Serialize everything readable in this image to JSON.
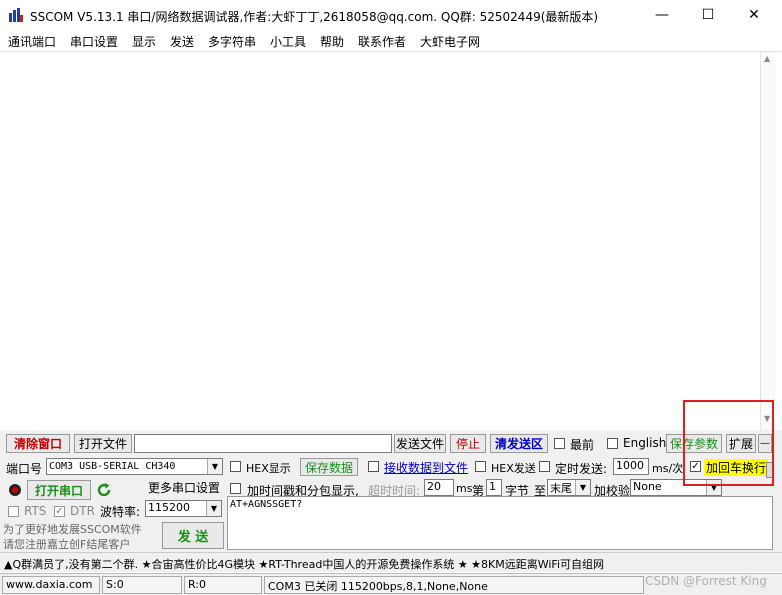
{
  "title": "SSCOM V5.13.1 串口/网络数据调试器,作者:大虾丁丁,2618058@qq.com. QQ群: 52502449(最新版本)",
  "window_controls": {
    "minimize": "—",
    "maximize": "☐",
    "close": "✕"
  },
  "menu": [
    "通讯端口",
    "串口设置",
    "显示",
    "发送",
    "多字符串",
    "小工具",
    "帮助",
    "联系作者",
    "大虾电子网"
  ],
  "toolbar": {
    "clear_window": "清除窗口",
    "open_file": "打开文件",
    "send_file": "发送文件",
    "stop": "停止",
    "clear_send": "清发送区",
    "topmost": "最前",
    "english": "English",
    "save_params": "保存参数",
    "expand": "扩展",
    "collapse": "—"
  },
  "port": {
    "label": "端口号",
    "value": "COM3 USB-SERIAL CH340",
    "open_button": "打开串口",
    "more_settings": "更多串口设置",
    "rts": "RTS",
    "dtr": "DTR",
    "baud_label": "波特率:",
    "baud_value": "115200"
  },
  "options": {
    "hex_display": "HEX显示",
    "save_data": "保存数据",
    "recv_to_file": "接收数据到文件",
    "hex_send": "HEX发送",
    "timed_send": "定时发送:",
    "interval_value": "1000",
    "interval_unit": "ms/次",
    "add_crlf": "加回车换行",
    "timestamp": "加时间戳和分包显示,",
    "timeout_label": "超时时间:",
    "timeout_value": "20",
    "timeout_unit": "ms",
    "byte_prefix": "第",
    "byte_value": "1",
    "byte_unit": "字节",
    "to_label": "至",
    "end_value": "末尾",
    "checksum_label": "加校验",
    "checksum_value": "None"
  },
  "promo": {
    "line1": "为了更好地发展SSCOM软件",
    "line2": "请您注册嘉立创F结尾客户"
  },
  "send_button": "发 送",
  "send_text": "AT+AGNSSGET?",
  "ticker": "▲Q群满员了,没有第二个群. ★合宙高性价比4G模块 ★RT-Thread中国人的开源免费操作系统 ★ ★8KM远距离WiFi可自组网",
  "status": {
    "website": "www.daxia.com",
    "sent": "S:0",
    "received": "R:0",
    "port_status": "COM3 已关闭  115200bps,8,1,None,None"
  },
  "watermark": "CSDN @Forrest King",
  "colors": {
    "accent_red": "#c00000",
    "accent_green": "#1a8f1a",
    "highlight_yellow": "#ffff00",
    "annotation_red": "#e02020"
  }
}
